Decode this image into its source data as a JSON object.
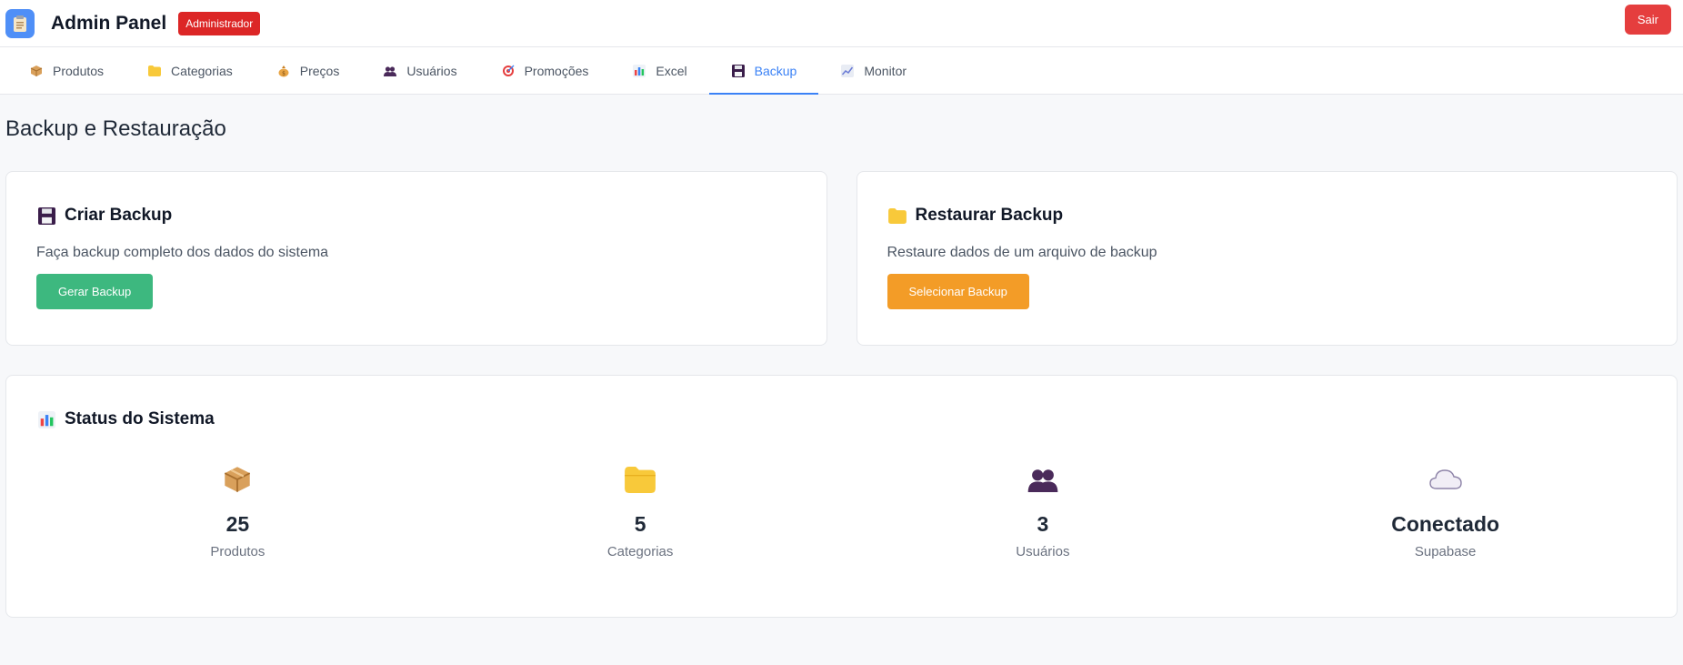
{
  "header": {
    "title": "Admin Panel",
    "role_badge": "Administrador",
    "logout_label": "Sair",
    "logo_icon": "clipboard-icon"
  },
  "tabs": [
    {
      "label": "Produtos",
      "icon": "package-icon",
      "active": false
    },
    {
      "label": "Categorias",
      "icon": "folder-icon",
      "active": false
    },
    {
      "label": "Preços",
      "icon": "money-bag-icon",
      "active": false
    },
    {
      "label": "Usuários",
      "icon": "users-icon",
      "active": false
    },
    {
      "label": "Promoções",
      "icon": "target-icon",
      "active": false
    },
    {
      "label": "Excel",
      "icon": "bar-chart-icon",
      "active": false
    },
    {
      "label": "Backup",
      "icon": "floppy-disk-icon",
      "active": true
    },
    {
      "label": "Monitor",
      "icon": "trend-chart-icon",
      "active": false
    }
  ],
  "page": {
    "title": "Backup e Restauração"
  },
  "create_backup": {
    "title": "Criar Backup",
    "icon": "floppy-disk-icon",
    "description": "Faça backup completo dos dados do sistema",
    "button_label": "Gerar Backup"
  },
  "restore_backup": {
    "title": "Restaurar Backup",
    "icon": "folder-icon",
    "description": "Restaure dados de um arquivo de backup",
    "button_label": "Selecionar Backup"
  },
  "system_status": {
    "title": "Status do Sistema",
    "icon": "bar-chart-icon",
    "stats": [
      {
        "value": "25",
        "label": "Produtos",
        "icon": "package-icon"
      },
      {
        "value": "5",
        "label": "Categorias",
        "icon": "folder-icon"
      },
      {
        "value": "3",
        "label": "Usuários",
        "icon": "users-icon"
      },
      {
        "value": "Conectado",
        "label": "Supabase",
        "icon": "cloud-icon"
      }
    ]
  },
  "colors": {
    "accent": "#3b82f6",
    "danger": "#e53e3e",
    "badge": "#dc2626",
    "success": "#3db87f",
    "warning": "#f39c27"
  }
}
